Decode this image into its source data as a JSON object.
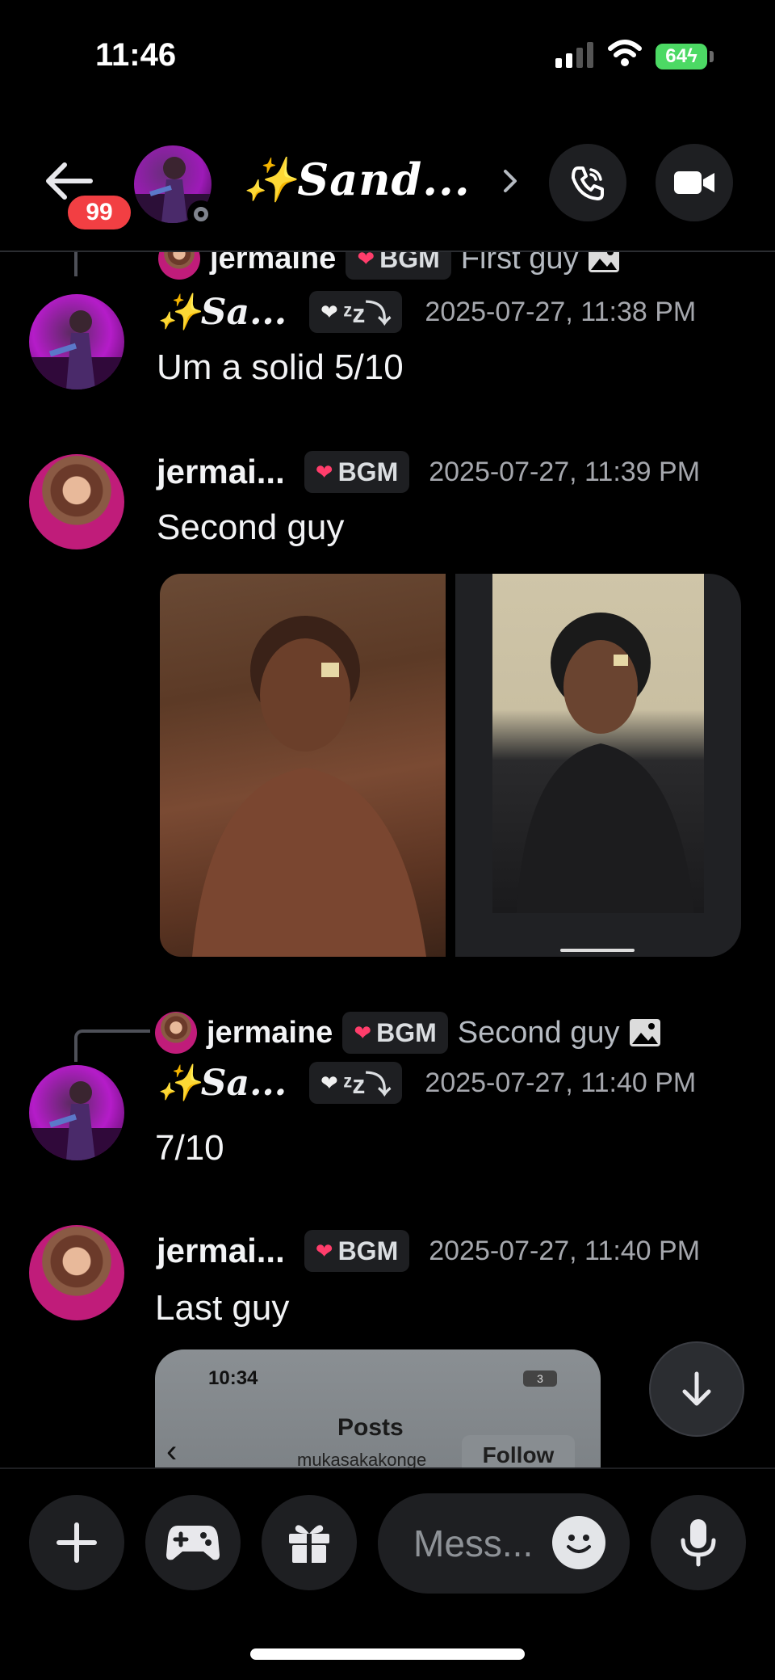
{
  "status_bar": {
    "time": "11:46",
    "battery": "64"
  },
  "header": {
    "unread_count": "99",
    "title": "✨𝑺𝒂𝒏𝒅...",
    "icons": [
      "back-arrow-icon",
      "call-icon",
      "video-icon"
    ]
  },
  "messages": [
    {
      "reply": {
        "name": "jermaine",
        "tag": "BGM",
        "text": "First guy"
      },
      "author": "✨𝑺𝒂...",
      "tag": "ᶻz⤵",
      "timestamp": "2025-07-27, 11:38 PM",
      "text": "Um a solid 5/10"
    },
    {
      "author": "jermai...",
      "tag": "BGM",
      "timestamp": "2025-07-27, 11:39 PM",
      "text": "Second guy"
    },
    {
      "reply": {
        "name": "jermaine",
        "tag": "BGM",
        "text": "Second guy"
      },
      "author": "✨𝑺𝒂...",
      "tag": "ᶻz⤵",
      "timestamp": "2025-07-27, 11:40 PM",
      "text": "7/10"
    },
    {
      "author": "jermai...",
      "tag": "BGM",
      "timestamp": "2025-07-27, 11:40 PM",
      "text": "Last guy"
    }
  ],
  "embedded_screenshot": {
    "time": "10:34",
    "battery": "3",
    "title": "Posts",
    "subtitle": "mukasakakonge",
    "follow": "Follow"
  },
  "composer": {
    "placeholder": "Mess...",
    "icons": [
      "plus-icon",
      "gamepad-icon",
      "gift-icon",
      "emoji-icon",
      "mic-icon"
    ]
  }
}
